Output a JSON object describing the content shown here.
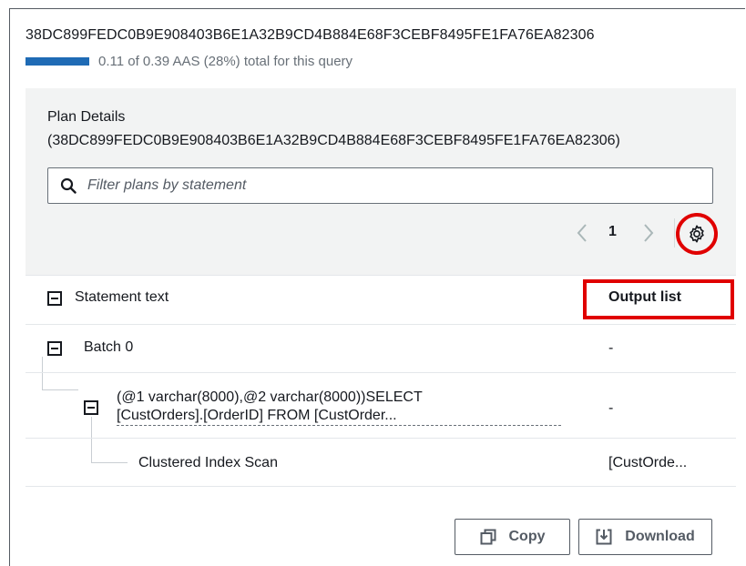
{
  "query": {
    "id": "38DC899FEDC0B9E908403B6E1A32B9CD4B884E68F3CEBF8495FE1FA76EA82306",
    "aas_text": "0.11 of 0.39 AAS (28%) total for this query",
    "aas_fraction": 0.28,
    "bar_color": "#1f6bb5"
  },
  "plan": {
    "title": "Plan Details",
    "id_text": "(38DC899FEDC0B9E908403B6E1A32B9CD4B884E68F3CEBF8495FE1FA76EA82306)",
    "filter_placeholder": "Filter plans by statement",
    "page": "1"
  },
  "table": {
    "col_statement": "Statement text",
    "col_output": "Output list",
    "rows": [
      {
        "statement": "Batch 0",
        "output": "-"
      },
      {
        "statement_line1": "(@1 varchar(8000),@2 varchar(8000))SELECT",
        "statement_line2": "[CustOrders].[OrderID] FROM [CustOrder...",
        "output": "-"
      },
      {
        "statement": "Clustered Index Scan",
        "output": "[CustOrde..."
      }
    ]
  },
  "buttons": {
    "copy": "Copy",
    "download": "Download"
  },
  "icons": {
    "search": "search-icon",
    "settings": "gear-icon",
    "prev": "chevron-left-icon",
    "next": "chevron-right-icon",
    "copy": "copy-icon",
    "download": "download-icon"
  },
  "highlight_color": "#e00000"
}
